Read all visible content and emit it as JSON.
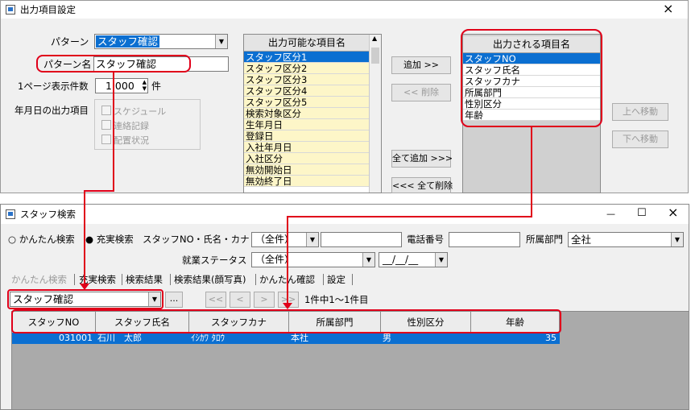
{
  "settings": {
    "title": "出力項目設定",
    "pattern_label": "パターン",
    "pattern_value": "スタッフ確認",
    "pattern_name_label": "パターン名",
    "pattern_name_value": "スタッフ確認",
    "per_page_label": "1ページ表示件数",
    "per_page_value": "1,000",
    "per_page_unit": "件",
    "date_group_label": "年月日の出力項目",
    "date_checks": [
      "スケジュール",
      "連絡記録",
      "配置状況"
    ],
    "available_header": "出力可能な項目名",
    "available_items": [
      "スタッフ区分1",
      "スタッフ区分2",
      "スタッフ区分3",
      "スタッフ区分4",
      "スタッフ区分5",
      "検索対象区分",
      "生年月日",
      "登録日",
      "入社年月日",
      "入社区分",
      "無効開始日",
      "無効終了日"
    ],
    "add_button": "追加 >>",
    "remove_button": "<< 削除",
    "add_all_button": "全て追加 >>>",
    "remove_all_button": "<<< 全て削除",
    "output_header": "出力される項目名",
    "output_items": [
      "スタッフNO",
      "スタッフ氏名",
      "スタッフカナ",
      "所属部門",
      "性別区分",
      "年齢"
    ],
    "move_up_button": "上へ移動",
    "move_down_button": "下へ移動",
    "close_glyph": "×"
  },
  "search": {
    "title": "スタッフ検索",
    "min_glyph": "—",
    "max_glyph": "☐",
    "close_glyph": "×",
    "mode_simple": "かんたん検索",
    "mode_full": "充実検索",
    "staff_field_label": "スタッフNO・氏名・カナ",
    "staff_field_select": "（全件）",
    "phone_label": "電話番号",
    "dept_label": "所属部門",
    "dept_value": "全社",
    "work_status_label": "就業ステータス",
    "work_status_value": "（全件）",
    "date_value": "__/__/__",
    "tabs": [
      "かんたん検索",
      "充実検索",
      "検索結果",
      "検索結果(顔写真)",
      "かんたん確認",
      "設定"
    ],
    "pattern_select": "スタッフ確認",
    "ellipsis_button": "...",
    "nav": [
      "<<",
      "<",
      ">",
      ">>"
    ],
    "page_info": "1件中1～1件目",
    "columns": [
      "スタッフNO",
      "スタッフ氏名",
      "スタッフカナ",
      "所属部門",
      "性別区分",
      "年齢"
    ],
    "rows": [
      {
        "no": "031001",
        "name": "石川　太郎",
        "kana": "ｲｼｶﾜ ﾀﾛｳ",
        "dept": "本社",
        "gender": "男",
        "age": "35"
      }
    ]
  }
}
